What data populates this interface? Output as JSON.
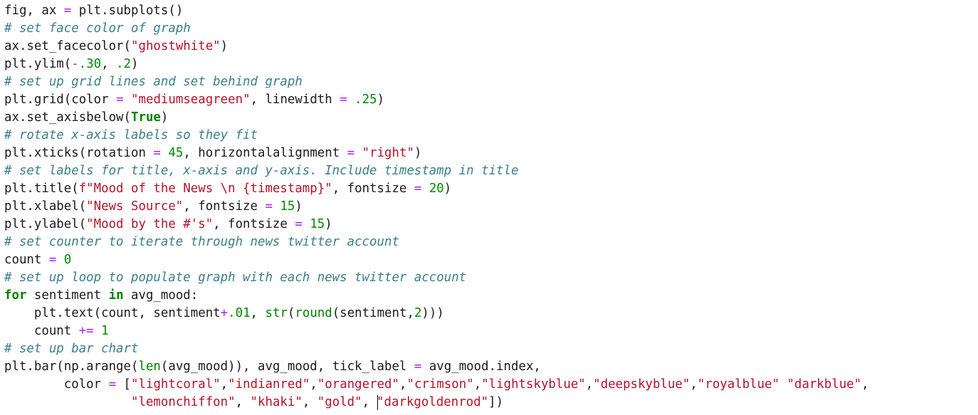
{
  "colors": {
    "background": "#ffffff",
    "text": "#1a1a1a",
    "comment": "#3b7f86",
    "string": "#b5122a",
    "number": "#008a00",
    "keyword": "#008000",
    "operator": "#aa22ff"
  },
  "editor": {
    "lines": [
      [
        [
          "plain",
          "fig, ax "
        ],
        [
          "op",
          "="
        ],
        [
          "plain",
          " plt.subplots()"
        ]
      ],
      [
        [
          "comment",
          "# set face color of graph"
        ]
      ],
      [
        [
          "plain",
          "ax.set_facecolor("
        ],
        [
          "string",
          "\"ghostwhite\""
        ],
        [
          "plain",
          ")"
        ]
      ],
      [
        [
          "plain",
          "plt.ylim("
        ],
        [
          "op",
          "-"
        ],
        [
          "number",
          ".30"
        ],
        [
          "plain",
          ", "
        ],
        [
          "number",
          ".2"
        ],
        [
          "plain",
          ")"
        ]
      ],
      [
        [
          "comment",
          "# set up grid lines and set behind graph"
        ]
      ],
      [
        [
          "plain",
          "plt.grid(color "
        ],
        [
          "op",
          "="
        ],
        [
          "plain",
          " "
        ],
        [
          "string",
          "\"mediumseagreen\""
        ],
        [
          "plain",
          ", linewidth "
        ],
        [
          "op",
          "="
        ],
        [
          "plain",
          " "
        ],
        [
          "number",
          ".25"
        ],
        [
          "plain",
          ")"
        ]
      ],
      [
        [
          "plain",
          "ax.set_axisbelow("
        ],
        [
          "keyword",
          "True"
        ],
        [
          "plain",
          ")"
        ]
      ],
      [
        [
          "comment",
          "# rotate x-axis labels so they fit"
        ]
      ],
      [
        [
          "plain",
          "plt.xticks(rotation "
        ],
        [
          "op",
          "="
        ],
        [
          "plain",
          " "
        ],
        [
          "number",
          "45"
        ],
        [
          "plain",
          ", horizontalalignment "
        ],
        [
          "op",
          "="
        ],
        [
          "plain",
          " "
        ],
        [
          "string",
          "\"right\""
        ],
        [
          "plain",
          ")"
        ]
      ],
      [
        [
          "comment",
          "# set labels for title, x-axis and y-axis. Include timestamp in title"
        ]
      ],
      [
        [
          "plain",
          "plt.title("
        ],
        [
          "string",
          "f\"Mood of the News \\n {timestamp}\""
        ],
        [
          "plain",
          ", fontsize "
        ],
        [
          "op",
          "="
        ],
        [
          "plain",
          " "
        ],
        [
          "number",
          "20"
        ],
        [
          "plain",
          ")"
        ]
      ],
      [
        [
          "plain",
          "plt.xlabel("
        ],
        [
          "string",
          "\"News Source\""
        ],
        [
          "plain",
          ", fontsize "
        ],
        [
          "op",
          "="
        ],
        [
          "plain",
          " "
        ],
        [
          "number",
          "15"
        ],
        [
          "plain",
          ")"
        ]
      ],
      [
        [
          "plain",
          "plt.ylabel("
        ],
        [
          "string",
          "\"Mood by the #'s\""
        ],
        [
          "plain",
          ", fontsize "
        ],
        [
          "op",
          "="
        ],
        [
          "plain",
          " "
        ],
        [
          "number",
          "15"
        ],
        [
          "plain",
          ")"
        ]
      ],
      [
        [
          "comment",
          "# set counter to iterate through news twitter account"
        ]
      ],
      [
        [
          "plain",
          "count "
        ],
        [
          "op",
          "="
        ],
        [
          "plain",
          " "
        ],
        [
          "number",
          "0"
        ]
      ],
      [
        [
          "comment",
          "# set up loop to populate graph with each news twitter account"
        ]
      ],
      [
        [
          "keyword",
          "for"
        ],
        [
          "plain",
          " sentiment "
        ],
        [
          "keyword",
          "in"
        ],
        [
          "plain",
          " avg_mood:"
        ]
      ],
      [
        [
          "plain",
          "    plt.text(count, sentiment"
        ],
        [
          "op",
          "+"
        ],
        [
          "number",
          ".01"
        ],
        [
          "plain",
          ", "
        ],
        [
          "builtin",
          "str"
        ],
        [
          "plain",
          "("
        ],
        [
          "builtin",
          "round"
        ],
        [
          "plain",
          "(sentiment,"
        ],
        [
          "number",
          "2"
        ],
        [
          "plain",
          ")))"
        ]
      ],
      [
        [
          "plain",
          "    count "
        ],
        [
          "op",
          "+="
        ],
        [
          "plain",
          " "
        ],
        [
          "number",
          "1"
        ]
      ],
      [
        [
          "comment",
          "# set up bar chart"
        ]
      ],
      [
        [
          "plain",
          "plt.bar(np.arange("
        ],
        [
          "builtin",
          "len"
        ],
        [
          "plain",
          "(avg_mood)), avg_mood, tick_label "
        ],
        [
          "op",
          "="
        ],
        [
          "plain",
          " avg_mood.index,"
        ]
      ],
      [
        [
          "plain",
          "        color "
        ],
        [
          "op",
          "="
        ],
        [
          "plain",
          " ["
        ],
        [
          "string",
          "\"lightcoral\""
        ],
        [
          "plain",
          ","
        ],
        [
          "string",
          "\"indianred\""
        ],
        [
          "plain",
          ","
        ],
        [
          "string",
          "\"orangered\""
        ],
        [
          "plain",
          ","
        ],
        [
          "string",
          "\"crimson\""
        ],
        [
          "plain",
          ","
        ],
        [
          "string",
          "\"lightskyblue\""
        ],
        [
          "plain",
          ","
        ],
        [
          "string",
          "\"deepskyblue\""
        ],
        [
          "plain",
          ","
        ],
        [
          "string",
          "\"royalblue\""
        ],
        [
          "plain",
          " "
        ],
        [
          "string",
          "\"darkblue\""
        ],
        [
          "plain",
          ","
        ]
      ],
      [
        [
          "plain",
          "                 "
        ],
        [
          "string",
          "\"lemonchiffon\""
        ],
        [
          "plain",
          ", "
        ],
        [
          "string",
          "\"khaki\""
        ],
        [
          "plain",
          ", "
        ],
        [
          "string",
          "\"gold\""
        ],
        [
          "plain",
          ", "
        ],
        [
          "cursor",
          ""
        ],
        [
          "string",
          "\"darkgoldenrod\""
        ],
        [
          "plain",
          "])"
        ]
      ]
    ]
  }
}
